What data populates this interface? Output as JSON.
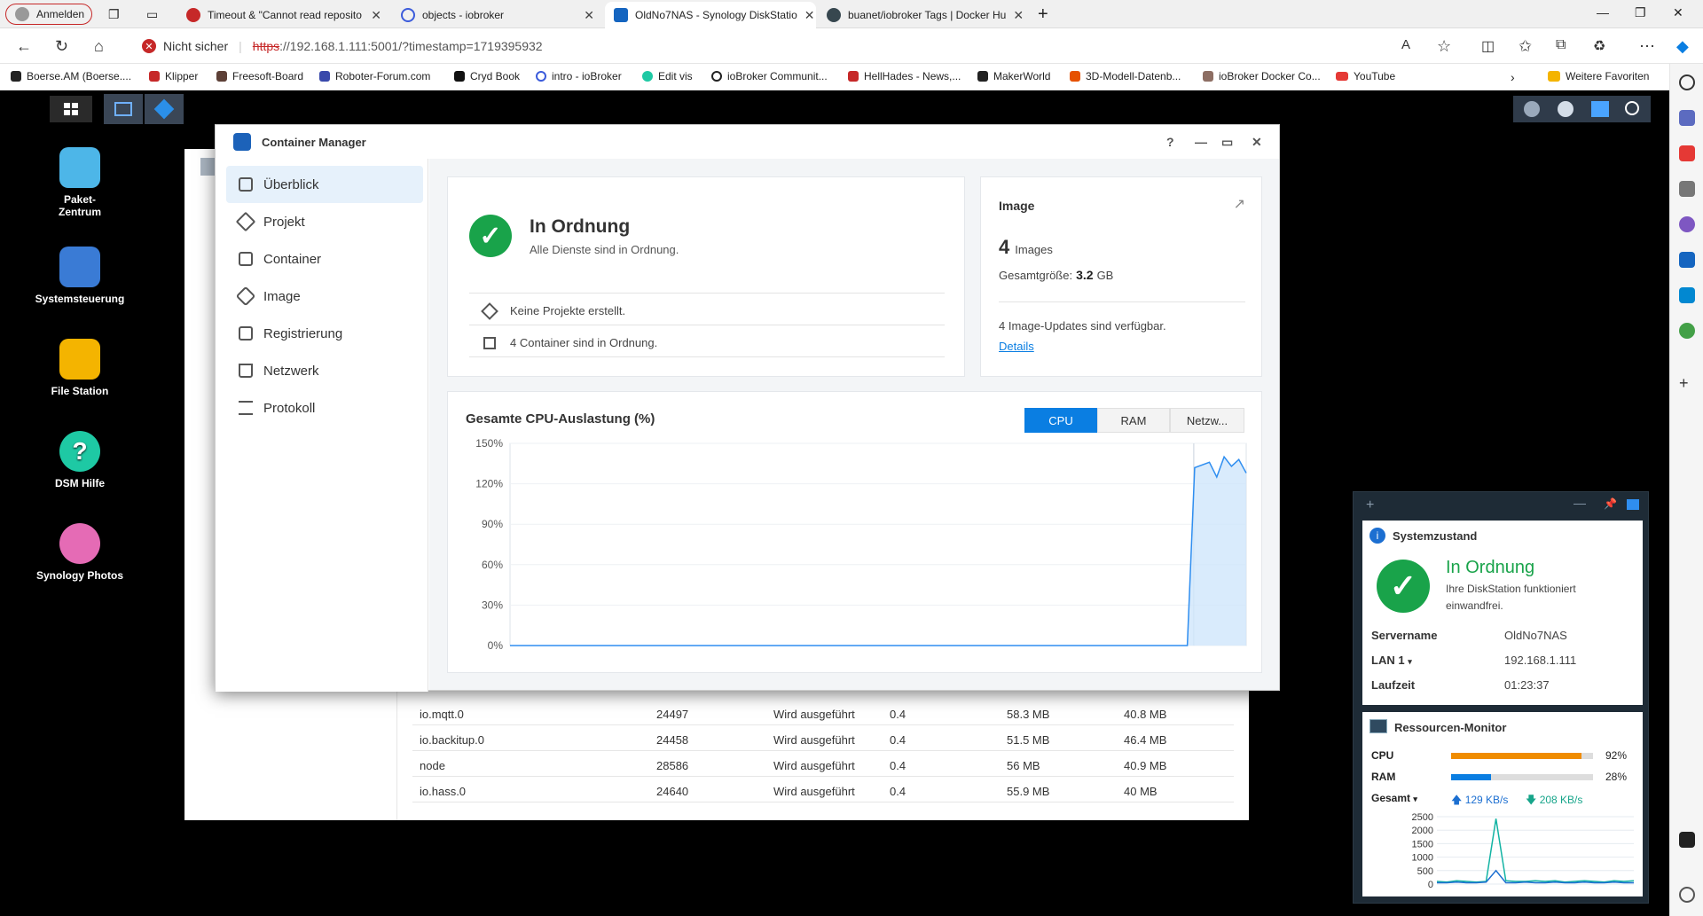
{
  "browser": {
    "profile": "Anmelden",
    "tabs": [
      {
        "title": "Timeout & \"Cannot read reposito",
        "icon_color": "#c62828"
      },
      {
        "title": "objects - iobroker",
        "icon_color": "#3b5bdb"
      },
      {
        "title": "OldNo7NAS - Synology DiskStatio",
        "icon_color": "#1565c0"
      },
      {
        "title": "buanet/iobroker Tags | Docker Hu",
        "icon_color": "#37474f"
      }
    ],
    "security_label": "Nicht sicher",
    "url_scheme": "https",
    "url_rest": "://192.168.1.111:5001/?timestamp=1719395932",
    "bookmarks": [
      "Boerse.AM (Boerse....",
      "Klipper",
      "Freesoft-Board",
      "Roboter-Forum.com",
      "Cryd Book",
      "intro - ioBroker",
      "Edit vis",
      "ioBroker Communit...",
      "HellHades - News,...",
      "MakerWorld",
      "3D-Modell-Datenb...",
      "ioBroker Docker Co...",
      "YouTube"
    ],
    "other_favorites": "Weitere Favoriten"
  },
  "desktop": {
    "icons": [
      {
        "label": "Paket-\nZentrum",
        "color": "#4db6e8"
      },
      {
        "label": "Systemsteuerung",
        "color": "#3a7bd5"
      },
      {
        "label": "File Station",
        "color": "#f4b400"
      },
      {
        "label": "DSM Hilfe",
        "color": "#1ec9a4"
      },
      {
        "label": "Synology Photos",
        "color": "#e56bb5"
      }
    ]
  },
  "background_table": {
    "rows": [
      [
        "io.mqtt.0",
        "24497",
        "Wird ausgeführt",
        "0.4",
        "58.3 MB",
        "40.8 MB"
      ],
      [
        "io.backitup.0",
        "24458",
        "Wird ausgeführt",
        "0.4",
        "51.5 MB",
        "46.4 MB"
      ],
      [
        "node",
        "28586",
        "Wird ausgeführt",
        "0.4",
        "56 MB",
        "40.9 MB"
      ],
      [
        "io.hass.0",
        "24640",
        "Wird ausgeführt",
        "0.4",
        "55.9 MB",
        "40 MB"
      ]
    ]
  },
  "container_manager": {
    "title": "Container Manager",
    "nav": [
      "Überblick",
      "Projekt",
      "Container",
      "Image",
      "Registrierung",
      "Netzwerk",
      "Protokoll"
    ],
    "status": {
      "title": "In Ordnung",
      "subtitle": "Alle Dienste sind in Ordnung.",
      "lines": [
        "Keine Projekte erstellt.",
        "4 Container sind in Ordnung."
      ]
    },
    "image": {
      "title": "Image",
      "count": "4",
      "count_label": "Images",
      "size_label": "Gesamtgröße:",
      "size_value": "3.2",
      "size_unit": "GB",
      "updates": "4 Image-Updates sind verfügbar.",
      "details_link": "Details"
    },
    "cpu_chart_title": "Gesamte CPU-Auslastung (%)",
    "tabs": [
      "CPU",
      "RAM",
      "Netzw..."
    ]
  },
  "chart_data": {
    "type": "area",
    "title": "Gesamte CPU-Auslastung (%)",
    "ylim": [
      0,
      150
    ],
    "yticks": [
      "150%",
      "120%",
      "90%",
      "60%",
      "30%",
      "0%"
    ],
    "grid": true,
    "x": [
      0,
      0.8,
      0.9,
      0.92,
      0.93,
      0.95,
      0.96,
      0.97,
      0.98,
      0.99,
      1.0
    ],
    "values": [
      0,
      0,
      0,
      0,
      132,
      136,
      125,
      140,
      133,
      138,
      128
    ]
  },
  "widget": {
    "system": {
      "title": "Systemzustand",
      "status": "In Ordnung",
      "desc": "Ihre DiskStation funktioniert einwandfrei.",
      "rows": [
        {
          "k": "Servername",
          "v": "OldNo7NAS"
        },
        {
          "k": "LAN 1",
          "v": "192.168.1.111"
        },
        {
          "k": "Laufzeit",
          "v": "01:23:37"
        }
      ]
    },
    "resource": {
      "title": "Ressourcen-Monitor",
      "cpu_label": "CPU",
      "cpu_pct": "92%",
      "cpu_value": 0.92,
      "ram_label": "RAM",
      "ram_pct": "28%",
      "ram_value": 0.28,
      "total_label": "Gesamt",
      "up": "129 KB/s",
      "down": "208 KB/s",
      "yticks": [
        "2500",
        "2000",
        "1500",
        "1000",
        "500",
        "0"
      ]
    },
    "colors": {
      "ok": "#19a34a",
      "cpu_bar": "#f08c00",
      "ram_bar": "#0a7ee2"
    }
  }
}
